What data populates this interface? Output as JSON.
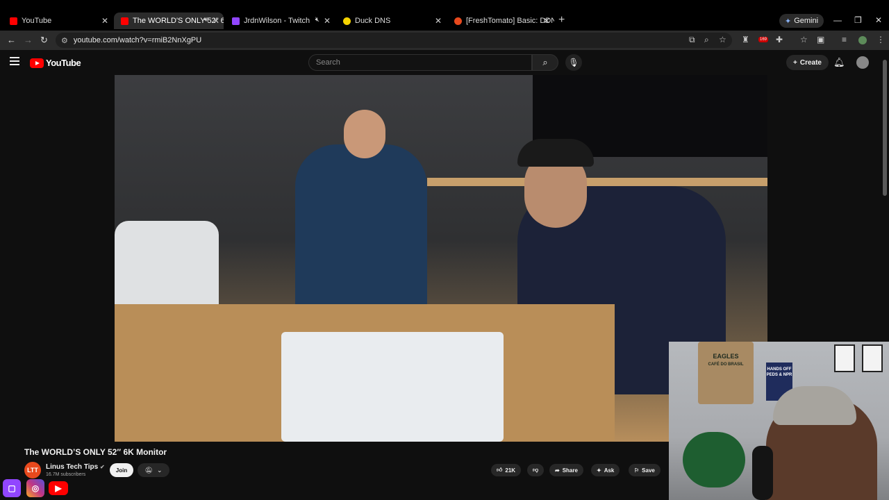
{
  "browser": {
    "tabs": [
      {
        "title": "YouTube",
        "icon": "youtube-icon",
        "color": "#ff0000"
      },
      {
        "title": "The WORLD'S ONLY 52\" 6K",
        "icon": "youtube-icon",
        "color": "#ff0000"
      },
      {
        "title": "JrdnWilson - Twitch",
        "icon": "twitch-icon",
        "color": "#9146ff"
      },
      {
        "title": "Duck DNS",
        "icon": "duck-icon",
        "color": "#f5d300"
      },
      {
        "title": "[FreshTomato] Basic: DDNS Clie",
        "icon": "tomato-icon",
        "color": "#e8491d"
      }
    ],
    "gemini_label": "Gemini",
    "url": "youtube.com/watch?v=rmiB2NnXgPU",
    "extension_badge": "169"
  },
  "youtube": {
    "logo_text": "YouTube",
    "search_placeholder": "Search",
    "create_label": "Create"
  },
  "video": {
    "title": "The WORLD’S ONLY 52″ 6K Monitor",
    "channel_name": "Linus Tech Tips",
    "channel_initials": "LTT",
    "subscribers": "16.7M subscribers",
    "join_label": "Join",
    "likes": "21K",
    "share_label": "Share",
    "ask_label": "Ask",
    "save_label": "Save"
  },
  "webcam": {
    "sign_text": "EAGLES",
    "sign_sub": "CAFÉ DO BRASIL",
    "poster_text": "HANDS OFF PEDS & NPR"
  },
  "colors": {
    "accent": "#ff0000",
    "twitch": "#9146ff",
    "instagram": "#c13584"
  }
}
